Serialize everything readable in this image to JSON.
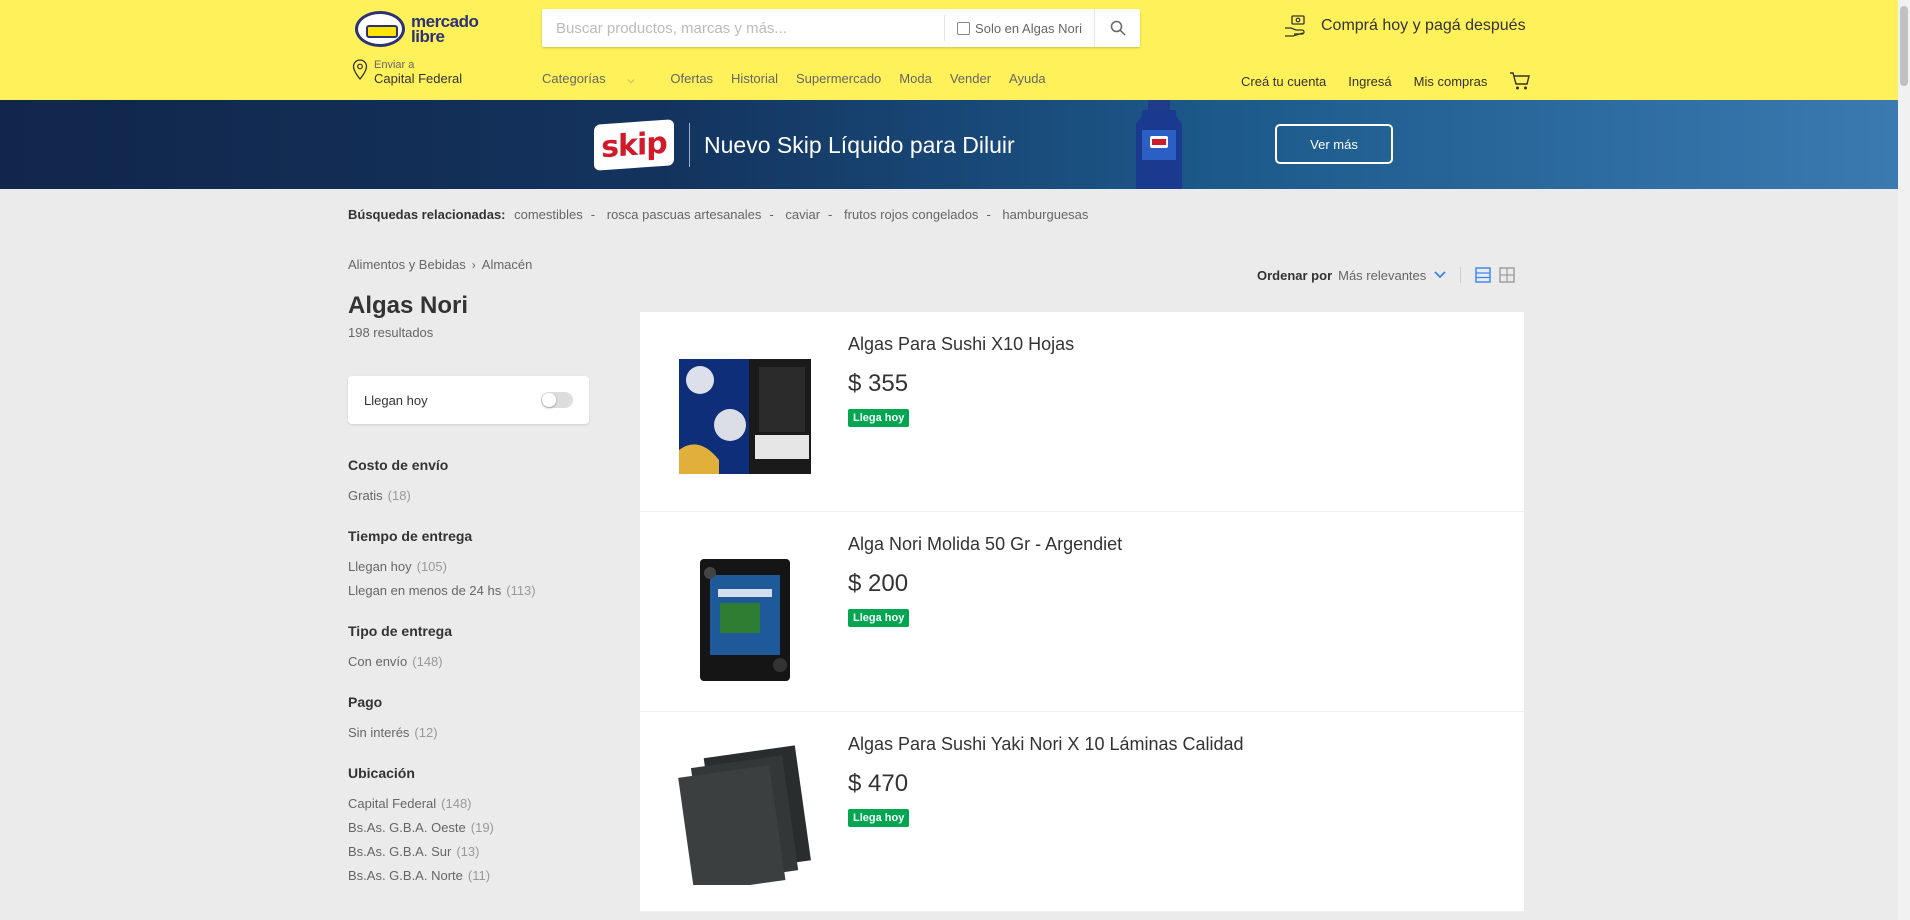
{
  "header": {
    "logo_line1": "mercado",
    "logo_line2": "libre",
    "search_placeholder": "Buscar productos, marcas y más...",
    "search_only_label": "Solo en Algas Nori",
    "promo": "Comprá hoy y pagá después",
    "location_label": "Enviar a",
    "location_value": "Capital Federal",
    "nav": [
      "Categorías",
      "Ofertas",
      "Historial",
      "Supermercado",
      "Moda",
      "Vender",
      "Ayuda"
    ],
    "user_nav": [
      "Creá tu cuenta",
      "Ingresá",
      "Mis compras"
    ]
  },
  "banner": {
    "logo": "skip",
    "text": "Nuevo Skip Líquido para Diluir",
    "button": "Ver más"
  },
  "related": {
    "label": "Búsquedas relacionadas:",
    "items": [
      "comestibles",
      "rosca pascuas artesanales",
      "caviar",
      "frutos rojos congelados",
      "hamburguesas"
    ]
  },
  "breadcrumb": [
    "Alimentos y Bebidas",
    "Almacén"
  ],
  "title": "Algas Nori",
  "result_count": "198 resultados",
  "toggle_label": "Llegan hoy",
  "filters": [
    {
      "title": "Costo de envío",
      "items": [
        {
          "label": "Gratis",
          "qty": "(18)"
        }
      ]
    },
    {
      "title": "Tiempo de entrega",
      "items": [
        {
          "label": "Llegan hoy",
          "qty": "(105)"
        },
        {
          "label": "Llegan en menos de 24 hs",
          "qty": "(113)"
        }
      ]
    },
    {
      "title": "Tipo de entrega",
      "items": [
        {
          "label": "Con envío",
          "qty": "(148)"
        }
      ]
    },
    {
      "title": "Pago",
      "items": [
        {
          "label": "Sin interés",
          "qty": "(12)"
        }
      ]
    },
    {
      "title": "Ubicación",
      "items": [
        {
          "label": "Capital Federal",
          "qty": "(148)"
        },
        {
          "label": "Bs.As. G.B.A. Oeste",
          "qty": "(19)"
        },
        {
          "label": "Bs.As. G.B.A. Sur",
          "qty": "(13)"
        },
        {
          "label": "Bs.As. G.B.A. Norte",
          "qty": "(11)"
        }
      ]
    }
  ],
  "sort": {
    "label": "Ordenar por",
    "value": "Más relevantes"
  },
  "results": [
    {
      "title": "Algas Para Sushi X10 Hojas",
      "price": "$ 355",
      "badge": "Llega hoy"
    },
    {
      "title": "Alga Nori Molida 50 Gr - Argendiet",
      "price": "$ 200",
      "badge": "Llega hoy"
    },
    {
      "title": "Algas Para Sushi Yaki Nori X 10 Láminas Calidad",
      "price": "$ 470",
      "badge": "Llega hoy"
    }
  ],
  "colors": {
    "header_bg": "#fff159",
    "badge_green": "#00a650",
    "accent_blue": "#3483fa"
  }
}
